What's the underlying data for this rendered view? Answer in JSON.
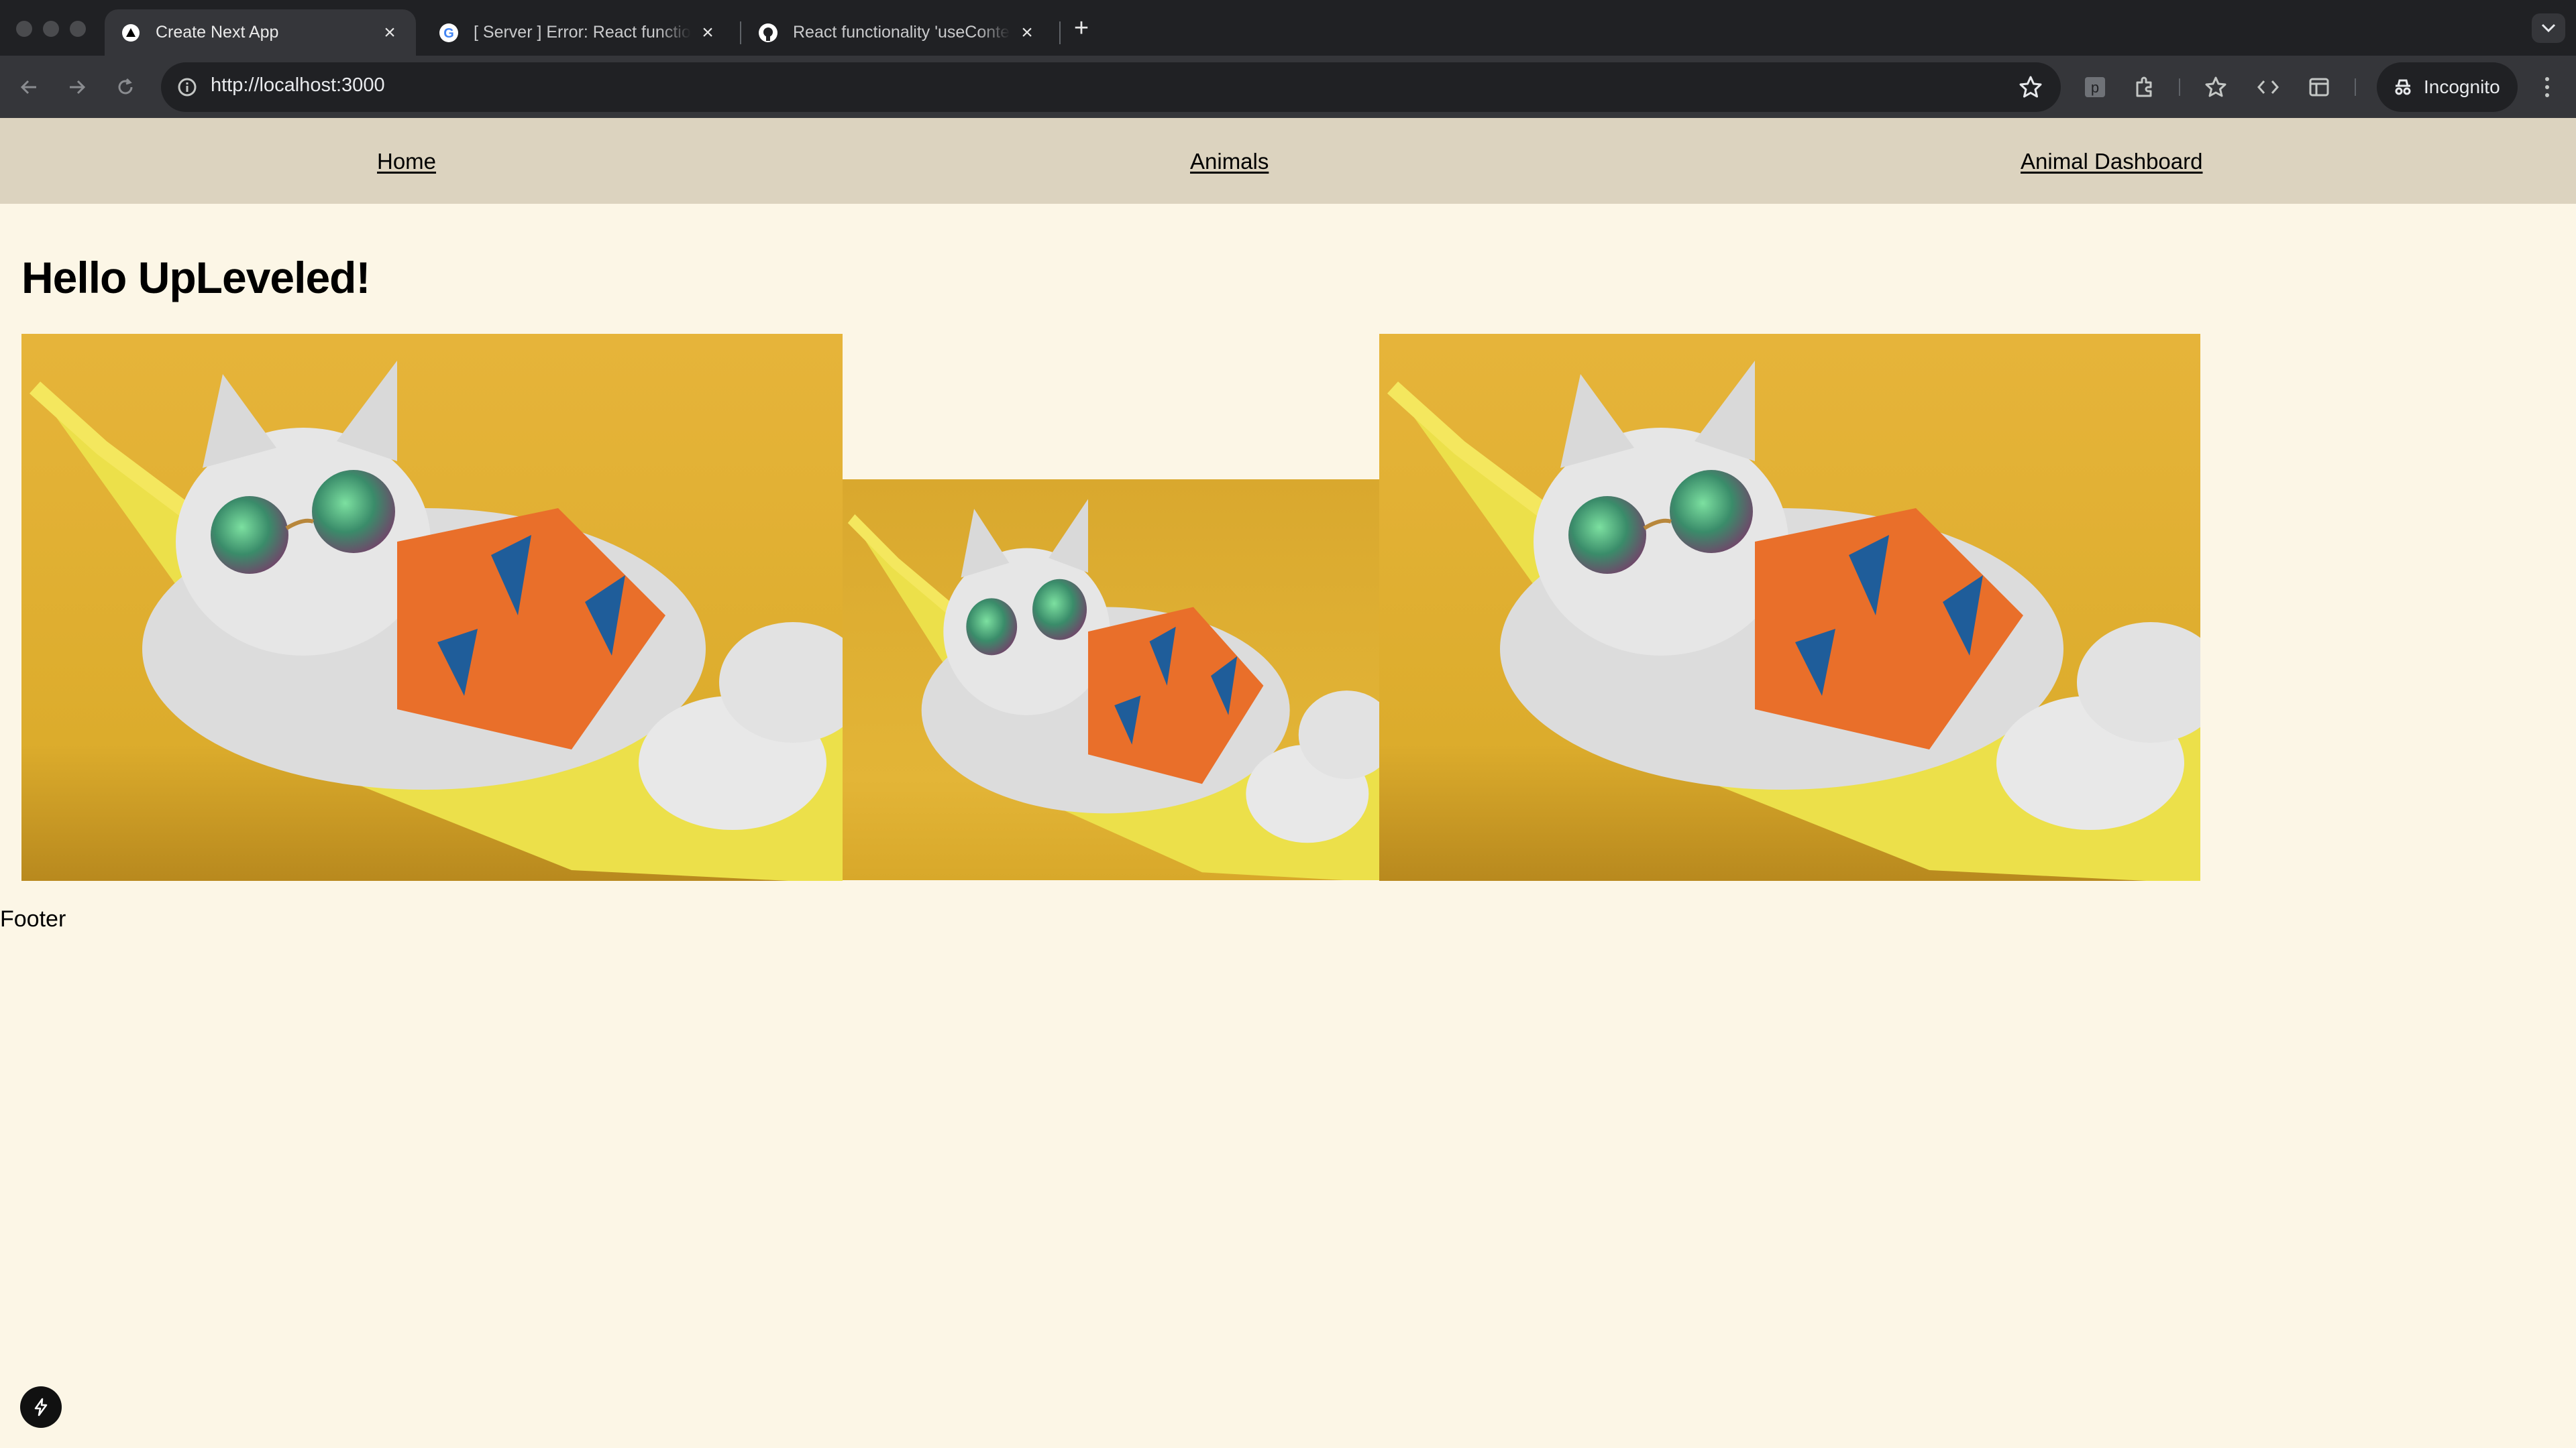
{
  "browser": {
    "tabs": [
      {
        "title": "Create Next App",
        "favicon": "nextjs-triangle-icon",
        "active": true
      },
      {
        "title": "[ Server ] Error: React functio",
        "favicon": "google-g-icon",
        "active": false
      },
      {
        "title": "React functionality 'useConte",
        "favicon": "github-icon",
        "active": false
      }
    ],
    "url": "http://localhost:3000",
    "profile_label": "Incognito"
  },
  "page": {
    "nav": {
      "home": "Home",
      "animals": "Animals",
      "dashboard": "Animal Dashboard"
    },
    "heading": "Hello UpLeveled!",
    "images": [
      {
        "alt": "cat with sunglasses in hammock"
      },
      {
        "alt": "cat with sunglasses in hammock"
      },
      {
        "alt": "cat with sunglasses in hammock"
      }
    ],
    "footer": "Footer"
  },
  "colors": {
    "page_bg": "#fcf6e6",
    "nav_bg": "#dcd3bf",
    "image_yellow": "#e3b537"
  }
}
